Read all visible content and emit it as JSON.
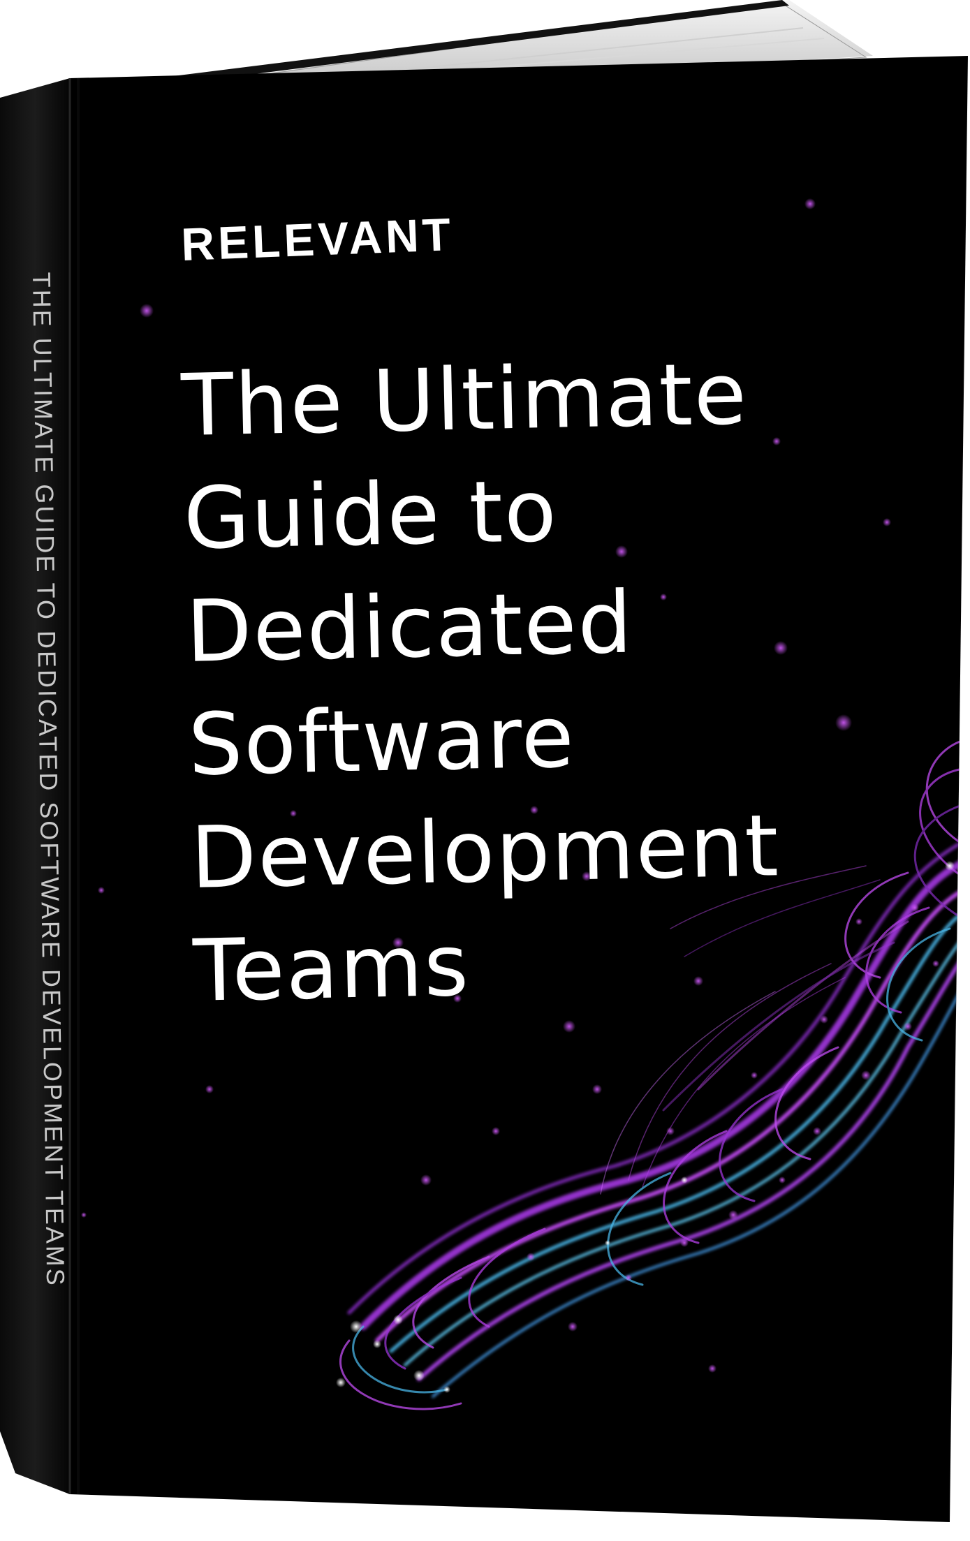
{
  "cover": {
    "brand": "RELEVANT",
    "title_lines": [
      "The Ultimate",
      "Guide to",
      "Dedicated",
      "Software",
      "Development",
      "Teams"
    ]
  },
  "spine": {
    "text": "THE ULTIMATE GUIDE TO DEDICATED SOFTWARE DEVELOPMENT TEAMS"
  },
  "colors": {
    "cover_background": "#000000",
    "text": "#ffffff",
    "accent_purple": "#b43cf0",
    "accent_cyan": "#4fb8e6",
    "pages": "#e8e8e8"
  }
}
